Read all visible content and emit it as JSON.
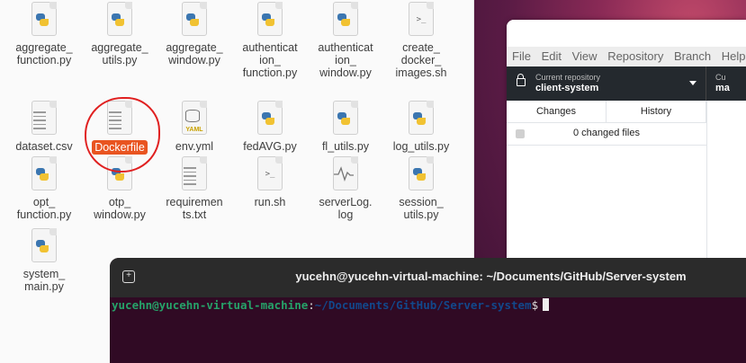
{
  "files": [
    {
      "name": "aggregate_\nfunction.py",
      "type": "python"
    },
    {
      "name": "aggregate_\nutils.py",
      "type": "python"
    },
    {
      "name": "aggregate_\nwindow.py",
      "type": "python"
    },
    {
      "name": "authenticat\nion_\nfunction.py",
      "type": "python"
    },
    {
      "name": "authenticat\nion_\nwindow.py",
      "type": "python"
    },
    {
      "name": "create_\ndocker_\nimages.sh",
      "type": "shell"
    },
    {
      "name": "dataset.csv",
      "type": "text"
    },
    {
      "name": "Dockerfile",
      "type": "text",
      "selected": true
    },
    {
      "name": "env.yml",
      "type": "yaml"
    },
    {
      "name": "fedAVG.py",
      "type": "python"
    },
    {
      "name": "fl_utils.py",
      "type": "python"
    },
    {
      "name": "log_utils.py",
      "type": "python"
    },
    {
      "name": "opt_\nfunction.py",
      "type": "python"
    },
    {
      "name": "otp_\nwindow.py",
      "type": "python"
    },
    {
      "name": "requiremen\nts.txt",
      "type": "text"
    },
    {
      "name": "run.sh",
      "type": "shell"
    },
    {
      "name": "serverLog.\nlog",
      "type": "log"
    },
    {
      "name": "session_\nutils.py",
      "type": "python"
    },
    {
      "name": "system_\nmain.py",
      "type": "python"
    }
  ],
  "icons": {
    "shell_glyph": ">_",
    "yaml_glyph": "YAML"
  },
  "github": {
    "menu": [
      "File",
      "Edit",
      "View",
      "Repository",
      "Branch",
      "Help"
    ],
    "repo_label": "Current repository",
    "repo_name": "client-system",
    "branch_label": "Cu",
    "branch_name": "ma",
    "tabs": [
      "Changes",
      "History"
    ],
    "changed_files": "0 changed files"
  },
  "terminal": {
    "title": "yucehn@yucehn-virtual-machine: ~/Documents/GitHub/Server-system",
    "prompt_user": "yucehn@yucehn-virtual-machine",
    "prompt_colon": ":",
    "prompt_path": "~/Documents/GitHub/Server-system",
    "prompt_dollar": "$",
    "new_tab_glyph": "+"
  },
  "colors": {
    "selection": "#e95420",
    "annotation": "#e02020",
    "terminal_bg": "#300a24",
    "prompt_user": "#26a269",
    "prompt_path": "#12488b"
  }
}
